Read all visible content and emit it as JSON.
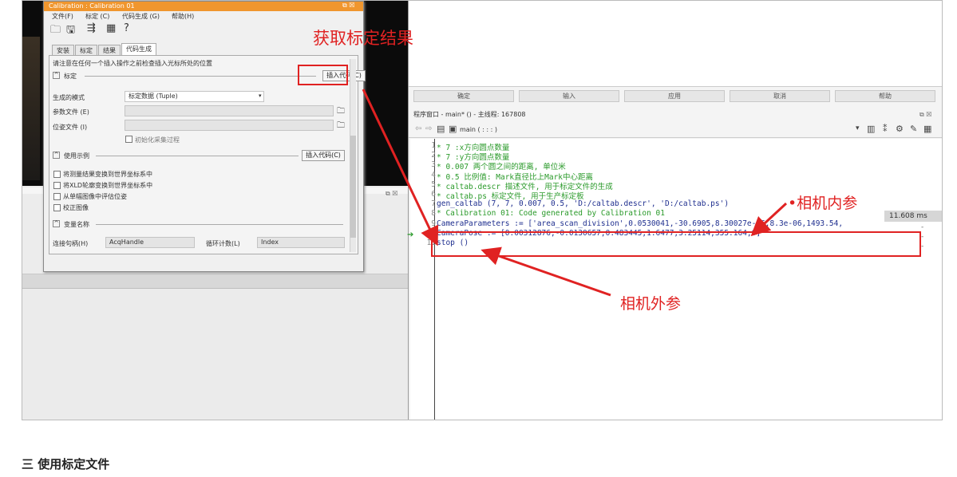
{
  "dialog": {
    "title": "Calibration : Calibration 01",
    "menu": [
      "文件(F)",
      "标定 (C)",
      "代码生成 (G)",
      "帮助(H)"
    ],
    "tabs": [
      "安装",
      "标定",
      "结果",
      "代码生成"
    ],
    "notice": "请注意在任何一个插入操作之前检查插入光标所处的位置",
    "section_calib": "标定",
    "insert_code": "插入代码(C)",
    "mode_label": "生成的模式",
    "mode_value": "标定数据 (Tuple)",
    "param_file_label": "参数文件 (E)",
    "pose_file_label": "位姿文件 (I)",
    "init_acq_label": "初始化采集过程",
    "section_example": "使用示例",
    "insert_code2": "插入代码(C)",
    "options": [
      "将测量结果变换到世界坐标系中",
      "将XLD轮廓变换到世界坐标系中",
      "从单幅图像中评估位姿",
      "校正图像"
    ],
    "section_varname": "变量名称",
    "handle_label": "连接句柄(H)",
    "handle_value": "AcqHandle",
    "loop_label": "循环计数(L)",
    "loop_value": "Index"
  },
  "right": {
    "buttons": [
      "确定",
      "输入",
      "应用",
      "取消",
      "帮助"
    ],
    "program_window_title": "程序窗口 - main* () - 主线程: 167808",
    "proc_select": "main ( : : : )",
    "timing": "11.608 ms",
    "code_lines": [
      {
        "no": "1",
        "text": "* 7 :x方向圆点数量"
      },
      {
        "no": "2",
        "text": "* 7 :y方向圆点数量"
      },
      {
        "no": "3",
        "text": "* 0.007 两个圆之间的距离, 单位米"
      },
      {
        "no": "4",
        "text": "* 0.5 比例值: Mark直径比上Mark中心距离"
      },
      {
        "no": "5",
        "text": "* caltab.descr 描述文件, 用于标定文件的生成"
      },
      {
        "no": "6",
        "text": "* caltab.ps 标定文件, 用于生产标定板"
      },
      {
        "no": "7",
        "text": "gen_caltab (7, 7, 0.007, 0.5, 'D:/caltab.descr', 'D:/caltab.ps')"
      },
      {
        "no": "8",
        "text": "* Calibration 01: Code generated by Calibration 01"
      },
      {
        "no": "9",
        "text": "CameraParameters := ['area_scan_division',0.0530041,-30.6905,8.30027e-06,8.3e-06,1493.54,"
      },
      {
        "no": "10",
        "text": "CameraPose := [0.00312876,-0.0130657,0.483445,1.6477,3.25114,355.164,0]"
      },
      {
        "no": "11",
        "text": "stop ()"
      }
    ]
  },
  "annotations": {
    "get_result": "获取标定结果",
    "intrinsics": "•相机内参",
    "extrinsics": "相机外参"
  },
  "heading": "三 使用标定文件",
  "colors": {
    "accent_red": "#e02222",
    "title_orange": "#f0962e",
    "comment_green": "#2a9a2a"
  }
}
